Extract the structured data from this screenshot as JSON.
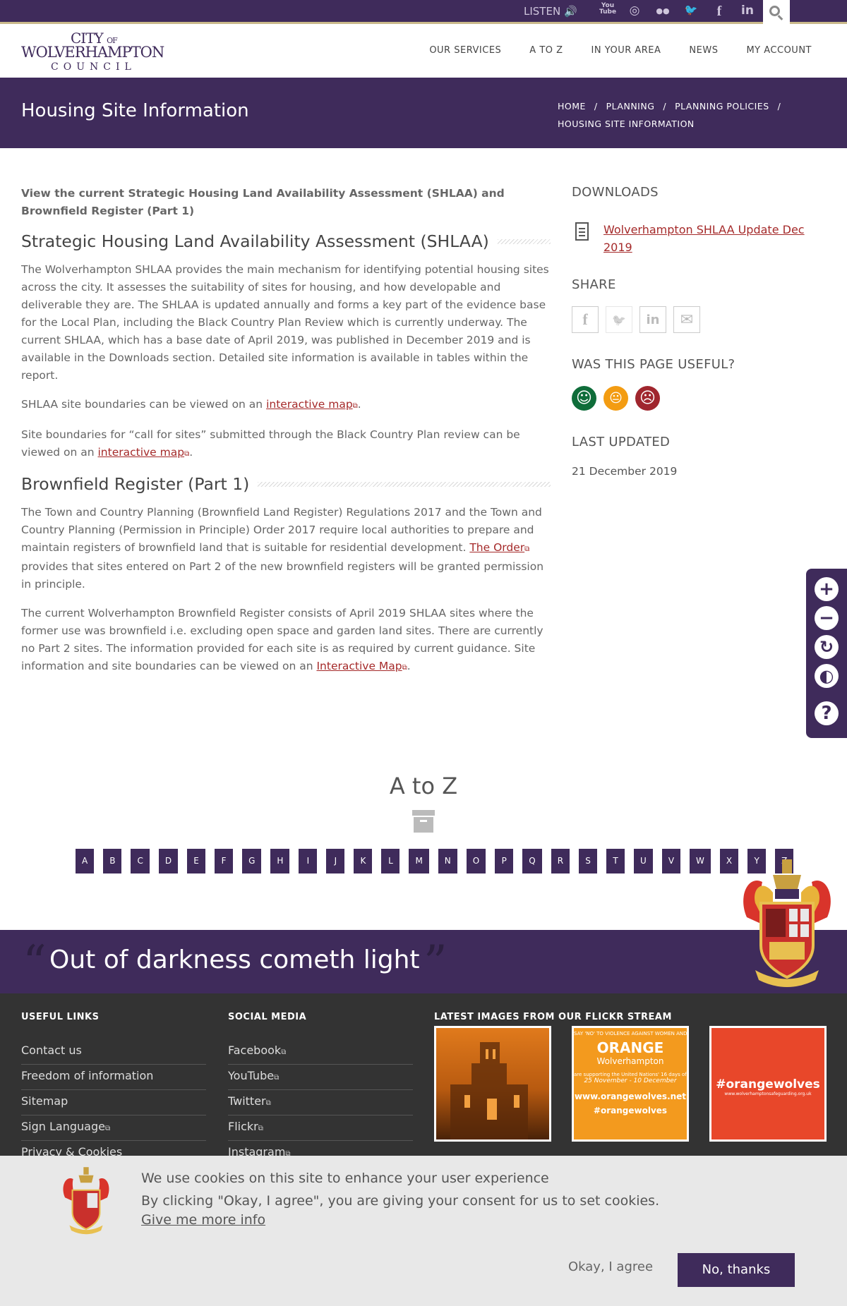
{
  "topbar": {
    "listen_label": "LISTEN",
    "speaker_glyph": "🔊",
    "social_icons": [
      "youtube-icon",
      "instagram-icon",
      "flickr-icon",
      "twitter-icon",
      "facebook-icon",
      "linkedin-icon"
    ],
    "social_glyphs": [
      "You\nTube",
      "◎",
      "●●",
      "🐦",
      "f",
      "in"
    ]
  },
  "logo": {
    "line1": "CITY",
    "line1_small": "OF",
    "line2": "WOLVERHAMPTON",
    "line3": "COUNCIL"
  },
  "nav": [
    "OUR SERVICES",
    "A TO Z",
    "IN YOUR AREA",
    "NEWS",
    "MY ACCOUNT"
  ],
  "page": {
    "title": "Housing Site Information",
    "breadcrumbs": [
      "HOME",
      "PLANNING",
      "PLANNING POLICIES",
      "HOUSING SITE INFORMATION"
    ]
  },
  "content": {
    "lead": "View the current Strategic Housing Land Availability Assessment (SHLAA) and Brownfield Register (Part 1)",
    "h_shlaa": "Strategic Housing Land Availability Assessment (SHLAA)",
    "p1": "The Wolverhampton SHLAA provides the main mechanism for identifying potential housing sites across the city. It assesses the suitability of sites for housing, and how developable and deliverable they are. The SHLAA is updated annually and forms a key part of the evidence base for the Local Plan, including the Black Country Plan Review which is currently underway. The current SHLAA, which has a base date of April 2019, was published in December 2019 and is available in the Downloads section. Detailed site information is available in tables within the report.",
    "p2_before": "SHLAA site boundaries can be viewed on an ",
    "p2_link": "interactive map",
    "p2_after": ".",
    "p3_before": "Site boundaries for “call for sites” submitted through the Black Country Plan review can be viewed on an ",
    "p3_link": "interactive map",
    "p3_after": ".",
    "h_brownfield": "Brownfield Register (Part 1)",
    "p4_before": "The Town and Country Planning (Brownfield Land Register) Regulations 2017 and the Town and Country Planning (Permission in Principle) Order 2017 require local authorities to prepare and maintain registers of brownfield land that is suitable for residential development. ",
    "p4_link": "The Order",
    "p4_after": " provides that sites entered on Part 2 of the new brownfield registers will be granted permission in principle.",
    "p5_before": "The current Wolverhampton Brownfield Register consists of April 2019 SHLAA sites where the former use was brownfield i.e. excluding open space and garden land sites. There are currently no Part 2 sites.  The information provided for each site is as required by current guidance.  Site information and site boundaries can be viewed on an ",
    "p5_link": "Interactive Map",
    "p5_after": "."
  },
  "aside": {
    "downloads_heading": "DOWNLOADS",
    "download_link": "Wolverhampton SHLAA Update Dec 2019",
    "share_heading": "SHARE",
    "share_icons": [
      "facebook-icon",
      "twitter-icon",
      "linkedin-icon",
      "email-icon"
    ],
    "share_glyphs": [
      "f",
      "🐦",
      "in",
      "✉"
    ],
    "useful_heading": "WAS THIS PAGE USEFUL?",
    "faces": [
      {
        "name": "happy-face-icon",
        "glyph": "☺",
        "color": "#0f6d3a"
      },
      {
        "name": "neutral-face-icon",
        "glyph": "😐",
        "color": "#f39c12"
      },
      {
        "name": "sad-face-icon",
        "glyph": "☹",
        "color": "#a0262e"
      }
    ],
    "updated_heading": "LAST UPDATED",
    "updated_date": "21 December 2019"
  },
  "tools": [
    {
      "name": "zoom-in-icon",
      "glyph": "+"
    },
    {
      "name": "zoom-out-icon",
      "glyph": "−"
    },
    {
      "name": "reset-icon",
      "glyph": "↻"
    },
    {
      "name": "contrast-icon",
      "glyph": "◐"
    },
    {
      "name": "help-icon",
      "glyph": "?"
    }
  ],
  "az": {
    "title": "A to Z",
    "letters": [
      "A",
      "B",
      "C",
      "D",
      "E",
      "F",
      "G",
      "H",
      "I",
      "J",
      "K",
      "L",
      "M",
      "N",
      "O",
      "P",
      "Q",
      "R",
      "S",
      "T",
      "U",
      "V",
      "W",
      "X",
      "Y",
      "Z"
    ]
  },
  "motto": {
    "open_quote": "“",
    "text": "Out of darkness cometh light",
    "close_quote": "”"
  },
  "footer": {
    "useful_heading": "USEFUL LINKS",
    "useful_links": [
      "Contact us",
      "Freedom of information",
      "Sitemap",
      "Sign Language",
      "Privacy & Cookies"
    ],
    "social_heading": "SOCIAL MEDIA",
    "social_links": [
      "Facebook",
      "YouTube",
      "Twitter",
      "Flickr",
      "Instagram"
    ],
    "flickr_heading": "LATEST IMAGES FROM OUR FLICKR STREAM",
    "flickr_images": [
      {
        "name": "flickr-image-church"
      },
      {
        "name": "flickr-image-orange-wolves",
        "top": "SAY 'NO' TO VIOLENCE AGAINST WOMEN AND GIRLS",
        "title": "ORANGE",
        "subtitle": "Wolverhampton",
        "line": "are supporting the United Nations' 16 days of activism",
        "dates": "25 November - 10 December",
        "url": "www.orangewolves.net",
        "tag": "#orangewolves"
      },
      {
        "name": "flickr-image-tshirt",
        "tag": "#orangewolves",
        "url": "www.wolverhamptonsafeguarding.org.uk"
      }
    ]
  },
  "cookie": {
    "line1": "We use cookies on this site to enhance your user experience",
    "line2": "By clicking \"Okay, I agree\", you are giving your consent for us to set cookies.",
    "more": "Give me more info",
    "agree": "Okay, I agree",
    "decline": "No, thanks"
  },
  "colors": {
    "brand_purple": "#3f2b5b",
    "link_red": "#a52a2a",
    "footer_bg": "#333333",
    "cookie_bg": "#e8e8e8"
  }
}
